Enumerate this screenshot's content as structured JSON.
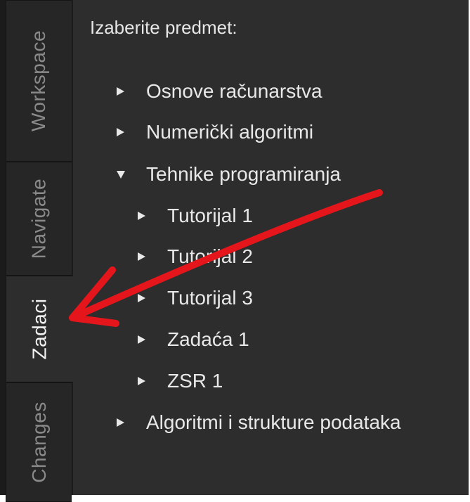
{
  "sidebar": {
    "tabs": [
      {
        "label": "Workspace",
        "active": false
      },
      {
        "label": "Navigate",
        "active": false
      },
      {
        "label": "Zadaci",
        "active": true
      },
      {
        "label": "Changes",
        "active": false
      }
    ]
  },
  "panel": {
    "heading": "Izaberite predmet:",
    "tree": [
      {
        "label": "Osnove računarstva",
        "expanded": false,
        "level": 0
      },
      {
        "label": "Numerički algoritmi",
        "expanded": false,
        "level": 0
      },
      {
        "label": "Tehnike programiranja",
        "expanded": true,
        "level": 0
      },
      {
        "label": "Tutorijal 1",
        "expanded": false,
        "level": 1
      },
      {
        "label": "Tutorijal 2",
        "expanded": false,
        "level": 1
      },
      {
        "label": "Tutorijal 3",
        "expanded": false,
        "level": 1
      },
      {
        "label": "Zadaća 1",
        "expanded": false,
        "level": 1
      },
      {
        "label": "ZSR 1",
        "expanded": false,
        "level": 1
      },
      {
        "label": "Algoritmi i strukture podataka",
        "expanded": false,
        "level": 0
      }
    ]
  },
  "colors": {
    "sidebar_bg": "#1b1b1b",
    "panel_bg": "#2d2d2d",
    "text": "#e8e8e8",
    "inactive_tab_text": "#8a8a8a",
    "annotation_arrow": "#e4161b"
  },
  "icons": {
    "collapsed": "triangle-right-icon",
    "expanded": "triangle-down-icon"
  }
}
